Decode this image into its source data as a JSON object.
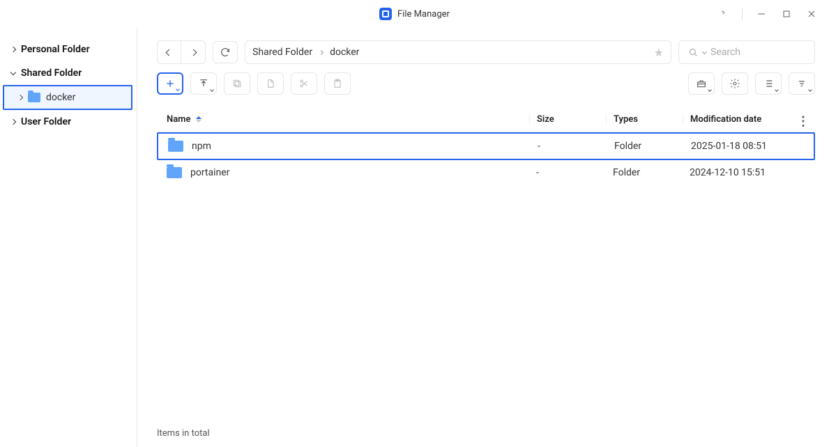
{
  "app": {
    "title": "File Manager"
  },
  "sidebar": {
    "items": [
      {
        "label": "Personal Folder",
        "expanded": false
      },
      {
        "label": "Shared Folder",
        "expanded": true
      },
      {
        "label": "User Folder",
        "expanded": false
      }
    ],
    "subitem": {
      "label": "docker"
    }
  },
  "breadcrumb": {
    "parent": "Shared Folder",
    "current": "docker"
  },
  "search": {
    "placeholder": "Search"
  },
  "columns": {
    "name": "Name",
    "size": "Size",
    "type": "Types",
    "date": "Modification date"
  },
  "rows": [
    {
      "name": "npm",
      "size": "-",
      "type": "Folder",
      "date": "2025-01-18 08:51",
      "selected": true
    },
    {
      "name": "portainer",
      "size": "-",
      "type": "Folder",
      "date": "2024-12-10 15:51",
      "selected": false
    }
  ],
  "status": {
    "text": "Items in total"
  }
}
